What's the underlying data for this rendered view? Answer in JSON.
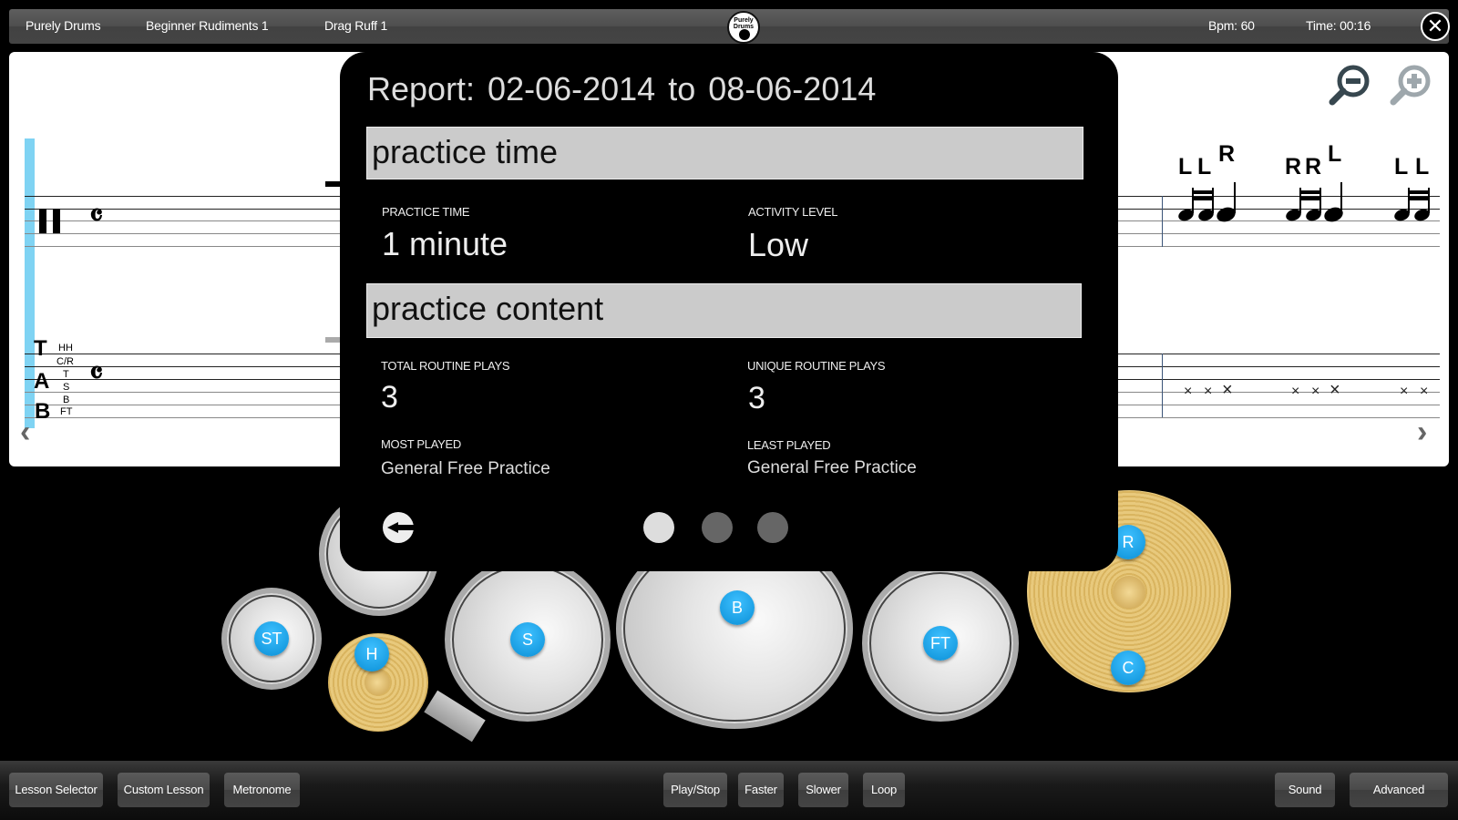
{
  "topbar": {
    "app_name": "Purely Drums",
    "lesson_group": "Beginner Rudiments 1",
    "lesson": "Drag Ruff 1",
    "logo_text": "Purely Drums",
    "bpm": "Bpm: 60",
    "time": "Time: 00:16",
    "close_icon": "✕"
  },
  "score": {
    "time_signature": "𝄴",
    "tab_letters": [
      "T",
      "A",
      "B"
    ],
    "tab_voices": [
      "HH",
      "C/R",
      "T",
      "S",
      "B",
      "FT"
    ],
    "sticking": [
      "L",
      "L",
      "R",
      "R",
      "R",
      "L",
      "L",
      "L"
    ],
    "prev_arrow": "‹",
    "next_arrow": "›",
    "x_mark": "×"
  },
  "report": {
    "title": "Report:  02-06-2014  to  08-06-2014",
    "sections": [
      {
        "heading": "practice time",
        "stats": [
          {
            "label": "PRACTICE TIME",
            "value": "1 minute"
          },
          {
            "label": "ACTIVITY LEVEL",
            "value": "Low"
          }
        ]
      },
      {
        "heading": "practice content",
        "stats": [
          {
            "label": "TOTAL ROUTINE PLAYS",
            "value": "3"
          },
          {
            "label": "UNIQUE ROUTINE PLAYS",
            "value": "3"
          },
          {
            "label": "MOST PLAYED",
            "value": "General Free Practice"
          },
          {
            "label": "LEAST PLAYED",
            "value": "General Free Practice"
          }
        ]
      }
    ],
    "page_count": 3,
    "active_page": 1
  },
  "drum_pads": {
    "small_tom": "ST",
    "hihat": "H",
    "snare": "S",
    "bass": "B",
    "floor_tom": "FT",
    "ride": "R",
    "crash": "C"
  },
  "toolbar": {
    "lesson_selector": "Lesson Selector",
    "custom_lesson": "Custom Lesson",
    "metronome": "Metronome",
    "play_stop": "Play/Stop",
    "faster": "Faster",
    "slower": "Slower",
    "loop": "Loop",
    "sound": "Sound",
    "advanced": "Advanced"
  },
  "colors": {
    "accent_blue": "#1aa3e8",
    "playhead": "#7fd3f3",
    "cymbal_gold": "#e2c070"
  }
}
